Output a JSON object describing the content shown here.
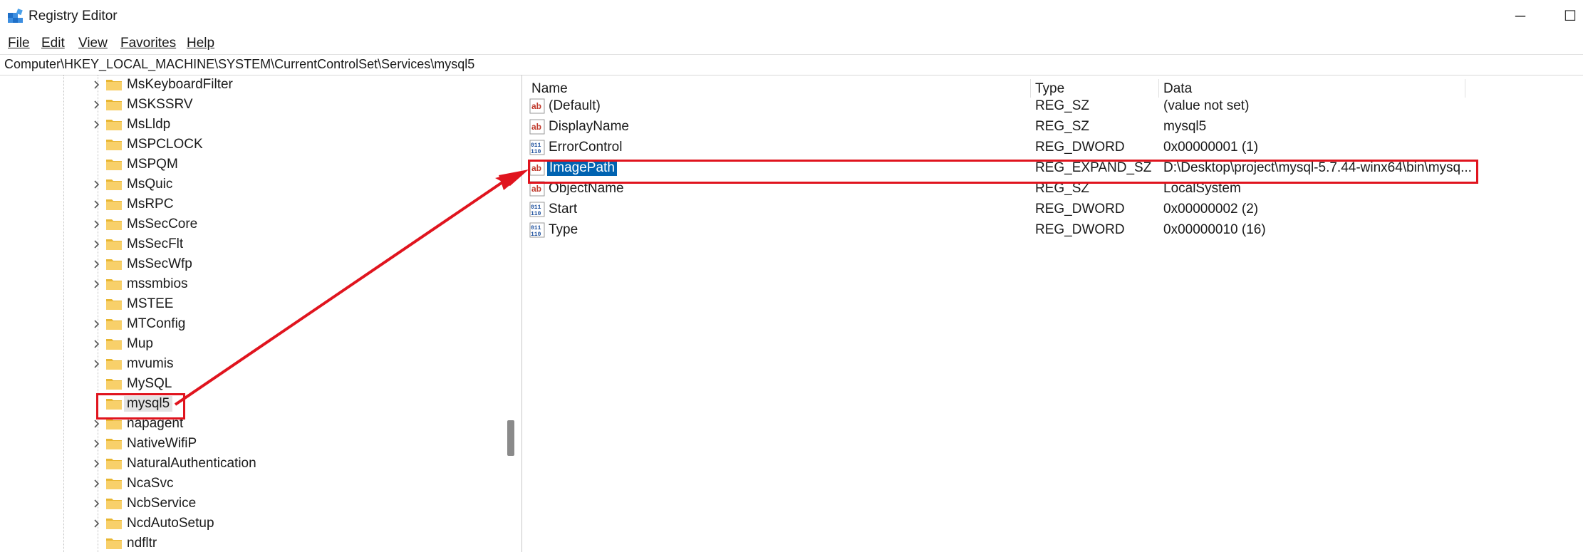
{
  "window": {
    "title": "Registry Editor",
    "minimize_glyph": "─",
    "maximize_glyph": "☐"
  },
  "menu": [
    "File",
    "Edit",
    "View",
    "Favorites",
    "Help"
  ],
  "address": "Computer\\HKEY_LOCAL_MACHINE\\SYSTEM\\CurrentControlSet\\Services\\mysql5",
  "tree": [
    {
      "label": "MsKeyboardFilter",
      "expandable": true
    },
    {
      "label": "MSKSSRV",
      "expandable": true
    },
    {
      "label": "MsLldp",
      "expandable": true
    },
    {
      "label": "MSPCLOCK",
      "expandable": false
    },
    {
      "label": "MSPQM",
      "expandable": false
    },
    {
      "label": "MsQuic",
      "expandable": true
    },
    {
      "label": "MsRPC",
      "expandable": true
    },
    {
      "label": "MsSecCore",
      "expandable": true
    },
    {
      "label": "MsSecFlt",
      "expandable": true
    },
    {
      "label": "MsSecWfp",
      "expandable": true
    },
    {
      "label": "mssmbios",
      "expandable": true
    },
    {
      "label": "MSTEE",
      "expandable": false
    },
    {
      "label": "MTConfig",
      "expandable": true
    },
    {
      "label": "Mup",
      "expandable": true
    },
    {
      "label": "mvumis",
      "expandable": true
    },
    {
      "label": "MySQL",
      "expandable": false
    },
    {
      "label": "mysql5",
      "expandable": false,
      "selected": true
    },
    {
      "label": "napagent",
      "expandable": true
    },
    {
      "label": "NativeWifiP",
      "expandable": true
    },
    {
      "label": "NaturalAuthentication",
      "expandable": true
    },
    {
      "label": "NcaSvc",
      "expandable": true
    },
    {
      "label": "NcbService",
      "expandable": true
    },
    {
      "label": "NcdAutoSetup",
      "expandable": true
    },
    {
      "label": "ndfltr",
      "expandable": false
    }
  ],
  "columns": {
    "name": "Name",
    "type": "Type",
    "data": "Data"
  },
  "values": [
    {
      "icon": "string-value-icon",
      "name": "(Default)",
      "type": "REG_SZ",
      "data": "(value not set)"
    },
    {
      "icon": "string-value-icon",
      "name": "DisplayName",
      "type": "REG_SZ",
      "data": "mysql5"
    },
    {
      "icon": "binary-value-icon",
      "name": "ErrorControl",
      "type": "REG_DWORD",
      "data": "0x00000001 (1)"
    },
    {
      "icon": "string-value-icon",
      "name": "ImagePath",
      "type": "REG_EXPAND_SZ",
      "data": "D:\\Desktop\\project\\mysql-5.7.44-winx64\\bin\\mysq...",
      "highlighted": true
    },
    {
      "icon": "string-value-icon",
      "name": "ObjectName",
      "type": "REG_SZ",
      "data": "LocalSystem"
    },
    {
      "icon": "binary-value-icon",
      "name": "Start",
      "type": "REG_DWORD",
      "data": "0x00000002 (2)"
    },
    {
      "icon": "binary-value-icon",
      "name": "Type",
      "type": "REG_DWORD",
      "data": "0x00000010 (16)"
    }
  ],
  "annotation_color": "#e0141e",
  "selection_color": "#0063b1"
}
